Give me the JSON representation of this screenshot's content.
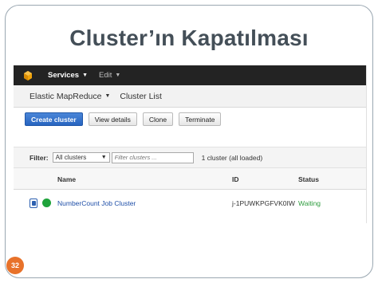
{
  "slide": {
    "title": "Cluster’ın Kapatılması",
    "page_number": "32"
  },
  "topbar": {
    "logo_icon": "aws-cube-icon",
    "services_label": "Services",
    "edit_label": "Edit"
  },
  "subnav": {
    "service_label": "Elastic MapReduce",
    "page_label": "Cluster List"
  },
  "toolbar": {
    "create_label": "Create cluster",
    "view_label": "View details",
    "clone_label": "Clone",
    "terminate_label": "Terminate"
  },
  "filter": {
    "label": "Filter:",
    "selected": "All clusters",
    "placeholder": "Filter clusters ...",
    "count_text": "1 cluster (all loaded)"
  },
  "table": {
    "columns": [
      "Name",
      "ID",
      "Status"
    ],
    "rows": [
      {
        "name": "NumberCount Job Cluster",
        "id": "j-1PUWKPGFVK0IW",
        "status": "Waiting"
      }
    ]
  },
  "colors": {
    "accent": "#2764c0",
    "status_ok": "#2e9c3e",
    "page_badge": "#e8722a"
  }
}
